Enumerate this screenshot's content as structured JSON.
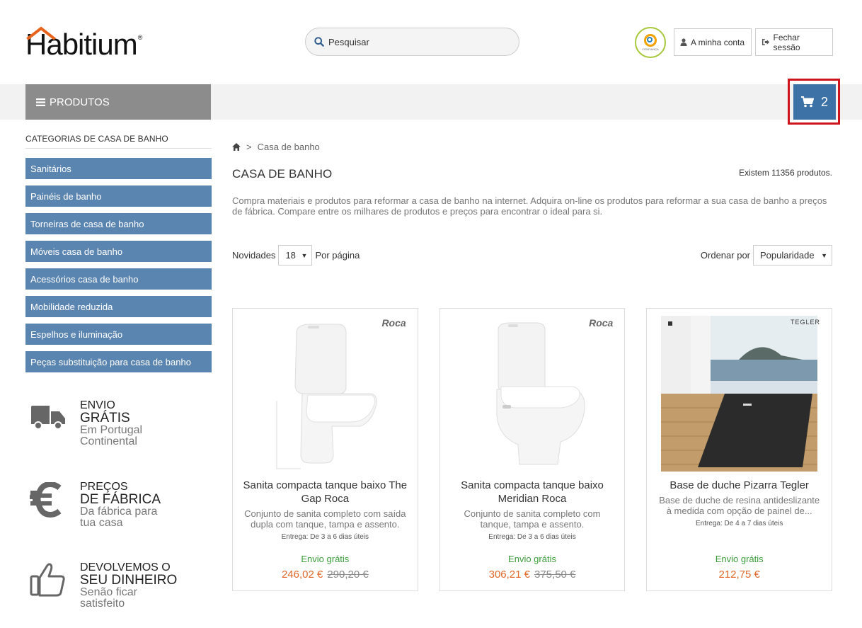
{
  "brand": {
    "name": "Habitium",
    "reg": "®"
  },
  "search": {
    "placeholder": "Pesquisar"
  },
  "header": {
    "trust_label": "CONFIANÇA",
    "account_label": "A minha conta",
    "logout_label": "Fechar sessão"
  },
  "nav": {
    "products_label": "PRODUTOS",
    "cart_count": "2"
  },
  "sidebar": {
    "title": "CATEGORIAS DE CASA DE BANHO",
    "items": [
      {
        "label": "Sanitários"
      },
      {
        "label": "Painéis de banho"
      },
      {
        "label": "Torneiras de casa de banho"
      },
      {
        "label": "Móveis casa de banho"
      },
      {
        "label": "Acessórios casa de banho"
      },
      {
        "label": "Mobilidade reduzida"
      },
      {
        "label": "Espelhos e iluminação"
      },
      {
        "label": "Peças substituição para casa de banho"
      }
    ],
    "promos": [
      {
        "line1": "ENVIO",
        "line2": "GRÁTIS",
        "line3": "Em Portugal",
        "line4": "Continental",
        "icon": "truck-icon"
      },
      {
        "line1": "PREÇOS",
        "line2": "DE FÁBRICA",
        "line3": "Da fábrica para",
        "line4": "tua casa",
        "icon": "euro-icon"
      },
      {
        "line1": "DEVOLVEMOS O",
        "line2": "SEU DINHEIRO",
        "line3": "Senão ficar",
        "line4": "satisfeito",
        "icon": "thumbs-up-icon"
      }
    ]
  },
  "main": {
    "breadcrumb": {
      "current": "Casa de banho",
      "separator": ">"
    },
    "title": "CASA DE BANHO",
    "count": "Existem 11356 produtos.",
    "description": "Compra materiais e produtos para reformar a casa de banho na internet. Adquira on-line os produtos para reformar a sua casa de banho a preços de fábrica. Compare entre os milhares de produtos e preços para encontrar o ideal para si.",
    "per_page": {
      "prefix": "Novidades",
      "value": "18",
      "suffix": "Por página"
    },
    "order": {
      "label": "Ordenar por",
      "value": "Popularidade"
    }
  },
  "products": [
    {
      "brand": "Roca",
      "name": "Sanita compacta tanque baixo The Gap Roca",
      "desc": "Conjunto de sanita completo com saída dupla com tanque, tampa e assento.",
      "delivery": "Entrega: De 3 a 6 dias úteis",
      "shipping": "Envio grátis",
      "price": "246,02 €",
      "old_price": "290,20 €"
    },
    {
      "brand": "Roca",
      "name": "Sanita compacta tanque baixo Meridian Roca",
      "desc": "Conjunto de sanita completo com tanque, tampa e assento.",
      "delivery": "Entrega: De 3 a 6 dias úteis",
      "shipping": "Envio grátis",
      "price": "306,21 €",
      "old_price": "375,50 €"
    },
    {
      "brand": "TEGLER",
      "name": "Base de duche Pizarra Tegler",
      "desc": "Base de duche de resina antideslizante à medida com opção de painel de...",
      "delivery": "Entrega: De 4 a 7 dias úteis",
      "shipping": "Envio grátis",
      "price": "212,75 €",
      "old_price": ""
    }
  ]
}
